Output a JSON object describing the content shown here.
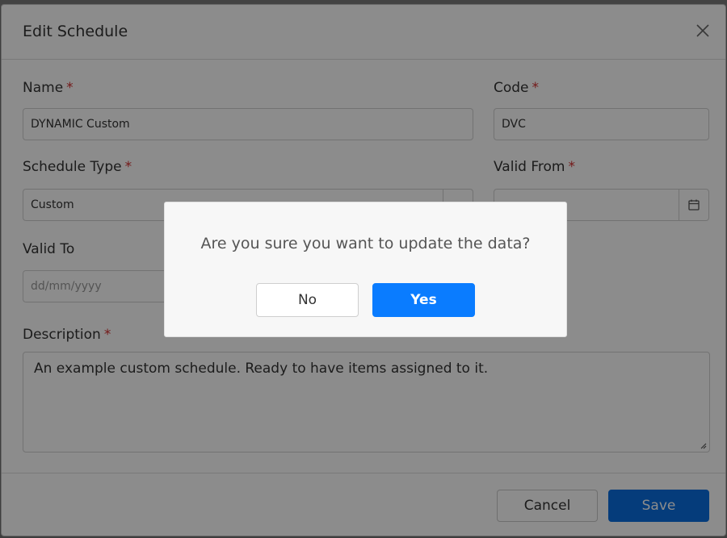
{
  "modal": {
    "title": "Edit Schedule",
    "close_icon": "close-icon"
  },
  "form": {
    "name": {
      "label": "Name",
      "required": "*",
      "value": "DYNAMIC Custom"
    },
    "code": {
      "label": "Code",
      "required": "*",
      "value": "DVC"
    },
    "schedule_type": {
      "label": "Schedule Type",
      "required": "*",
      "value": "Custom",
      "icon": "chevron-down-icon"
    },
    "valid_from": {
      "label": "Valid From",
      "required": "*",
      "value": "",
      "icon": "calendar-icon"
    },
    "valid_to": {
      "label": "Valid To",
      "placeholder": "dd/mm/yyyy"
    },
    "description": {
      "label": "Description",
      "required": "*",
      "value": "An example custom schedule. Ready to have items assigned to it."
    }
  },
  "footer": {
    "cancel_label": "Cancel",
    "save_label": "Save"
  },
  "confirm_dialog": {
    "message": "Are you sure you want to update the data?",
    "no_label": "No",
    "yes_label": "Yes"
  },
  "colors": {
    "primary": "#0a7cff",
    "save": "#0a6ee0",
    "required": "#d32f2f"
  }
}
